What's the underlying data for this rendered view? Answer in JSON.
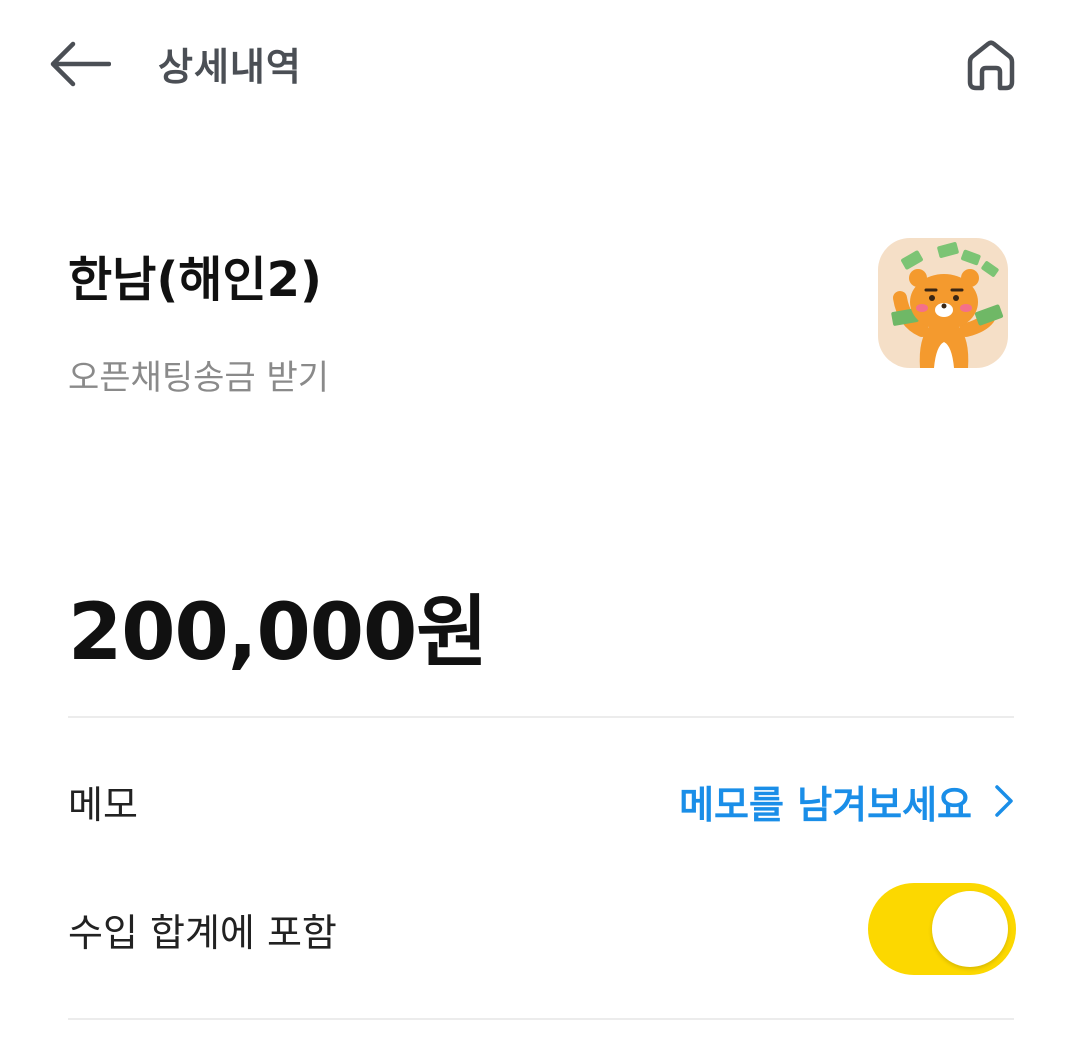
{
  "header": {
    "title": "상세내역",
    "back_icon": "arrow-left-icon",
    "home_icon": "home-icon"
  },
  "transaction": {
    "party_name": "한남(해인2)",
    "type": "오픈채팅송금 받기",
    "amount": "200,000원",
    "thumbnail": "ryan-money-character"
  },
  "memo": {
    "label": "메모",
    "action": "메모를 남겨보세요",
    "chevron_icon": "chevron-right-icon"
  },
  "income_total": {
    "label": "수입 합계에 포함",
    "enabled": true
  },
  "colors": {
    "accent_blue": "#1a8ee8",
    "toggle_yellow": "#fcd800",
    "title_gray": "#4b4f55",
    "subtext_gray": "#8a8a8a"
  }
}
